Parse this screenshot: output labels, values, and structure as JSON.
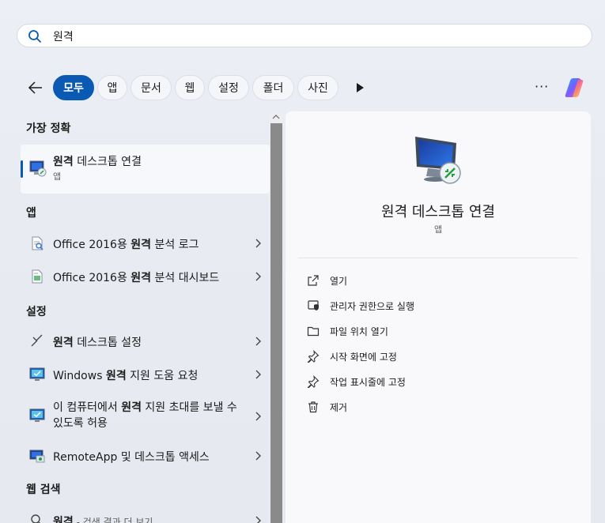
{
  "search": {
    "query": "원격"
  },
  "filters": [
    "모두",
    "앱",
    "문서",
    "웹",
    "설정",
    "폴더",
    "사진"
  ],
  "more_label": "···",
  "left": {
    "best_match_heading": "가장 정확",
    "best_match": {
      "title_bold": "원격",
      "title_rest": " 데스크톱 연결",
      "sub": "앱"
    },
    "apps_heading": "앱",
    "apps": [
      {
        "pre": "Office 2016용 ",
        "bold": "원격",
        "post": " 분석 로그"
      },
      {
        "pre": "Office 2016용 ",
        "bold": "원격",
        "post": " 분석 대시보드"
      }
    ],
    "settings_heading": "설정",
    "settings": [
      {
        "pre": "",
        "bold": "원격",
        "post": " 데스크톱 설정"
      },
      {
        "pre": "Windows ",
        "bold": "원격",
        "post": " 지원 도움 요청"
      },
      {
        "pre": "이 컴퓨터에서 ",
        "bold": "원격",
        "post": " 지원 초대를 보낼 수 있도록 허용"
      },
      {
        "pre": "RemoteApp 및 데스크톱 액세스",
        "bold": "",
        "post": ""
      }
    ],
    "web_heading": "웹 검색",
    "web": {
      "bold": "원격",
      "post": " - 검색 결과 더 보기"
    }
  },
  "right": {
    "title": "원격 데스크톱 연결",
    "sub": "앱",
    "actions": [
      "열기",
      "관리자 권한으로 실행",
      "파일 위치 열기",
      "시작 화면에 고정",
      "작업 표시줄에 고정",
      "제거"
    ]
  },
  "colors": {
    "accent": "#0a5ab4"
  }
}
